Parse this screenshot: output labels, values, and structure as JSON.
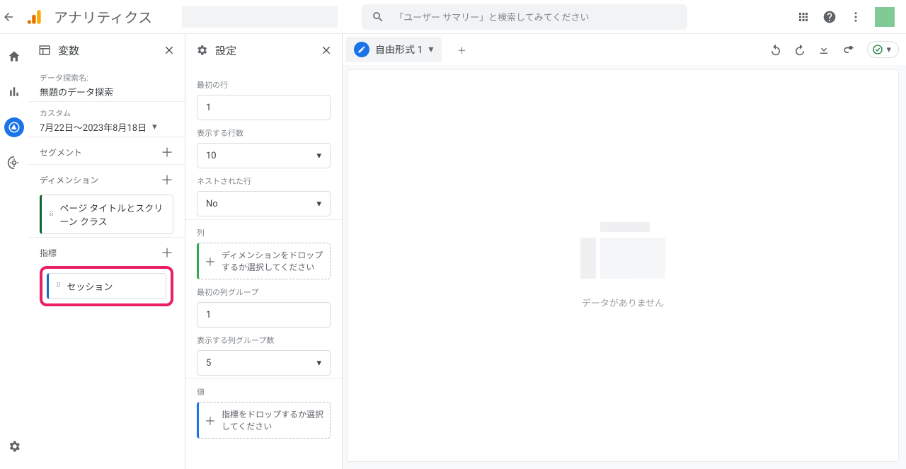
{
  "header": {
    "app_title": "アナリティクス",
    "search_placeholder": "「ユーザー サマリー」と検索してみてください"
  },
  "vars_panel": {
    "title": "変数",
    "exploration_name_label": "データ探索名:",
    "exploration_name": "無題のデータ探索",
    "date_range_label": "カスタム",
    "date_range": "7月22日〜2023年8月18日",
    "segments_label": "セグメント",
    "dimensions_label": "ディメンション",
    "dimension_chip": "ページ タイトルとスクリーン クラス",
    "metrics_label": "指標",
    "metric_chip": "セッション"
  },
  "settings_panel": {
    "title": "設定",
    "start_row_label": "最初の行",
    "start_row_value": "1",
    "show_rows_label": "表示する行数",
    "show_rows_value": "10",
    "nested_rows_label": "ネストされた行",
    "nested_rows_value": "No",
    "columns_label": "列",
    "columns_dropzone": "ディメンションをドロップするか選択してください",
    "first_col_group_label": "最初の列グループ",
    "first_col_group_value": "1",
    "show_col_groups_label": "表示する列グループ数",
    "show_col_groups_value": "5",
    "values_label": "値",
    "values_dropzone": "指標をドロップするか選択してください"
  },
  "canvas": {
    "tab_label": "自由形式 1",
    "empty_text": "データがありません"
  }
}
